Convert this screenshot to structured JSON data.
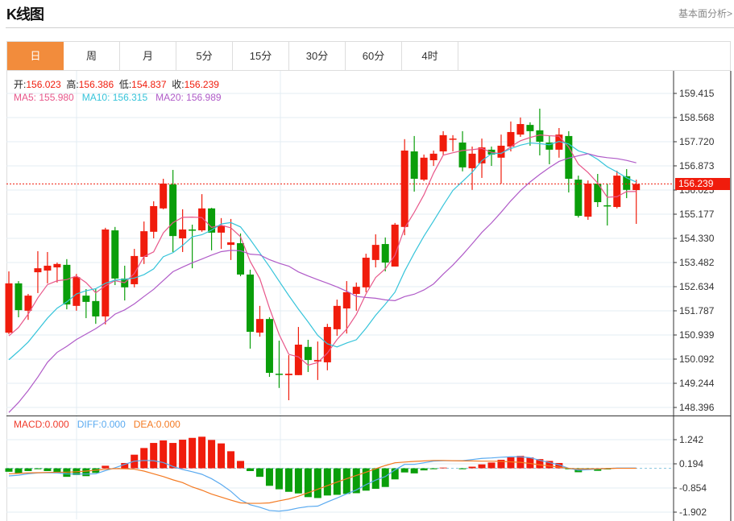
{
  "header": {
    "title": "K线图",
    "link": "基本面分析>"
  },
  "tabs": [
    {
      "label": "日",
      "active": true
    },
    {
      "label": "周"
    },
    {
      "label": "月"
    },
    {
      "label": "5分"
    },
    {
      "label": "15分"
    },
    {
      "label": "30分"
    },
    {
      "label": "60分"
    },
    {
      "label": "4时"
    }
  ],
  "ohlc_legend": {
    "open_label": "开:",
    "open": "156.023",
    "high_label": "高:",
    "high": "156.386",
    "low_label": "低:",
    "low": "154.837",
    "close_label": "收:",
    "close": "156.239"
  },
  "ma_legend": {
    "ma5": "MA5: 155.980",
    "ma10": "MA10: 156.315",
    "ma20": "MA20: 156.989"
  },
  "macd_legend": {
    "macd": "MACD:0.000",
    "diff": "DIFF:0.000",
    "dea": "DEA:0.000"
  },
  "current_price": "156.239",
  "colors": {
    "up": "#f01c0c",
    "down": "#0a9e0a",
    "ma5": "#e8578a",
    "ma10": "#36c4da",
    "ma20": "#b05bc8",
    "diff": "#5aaaf0",
    "dea": "#f47a22",
    "active_tab": "#f28c3c"
  },
  "chart_data": [
    {
      "type": "candlestick",
      "y_ticks": [
        "159.415",
        "158.568",
        "157.720",
        "156.873",
        "156.025",
        "155.177",
        "154.330",
        "153.482",
        "152.634",
        "151.787",
        "150.939",
        "150.092",
        "149.244",
        "148.396"
      ],
      "ylim": [
        148.396,
        159.415
      ],
      "ohlc": [
        [
          151.02,
          153.17,
          150.97,
          152.75
        ],
        [
          152.75,
          152.83,
          151.56,
          151.81
        ],
        [
          151.79,
          152.38,
          151.47,
          152.32
        ],
        [
          153.14,
          153.88,
          152.41,
          153.28
        ],
        [
          153.2,
          153.85,
          152.75,
          153.37
        ],
        [
          153.31,
          153.48,
          152.78,
          153.43
        ],
        [
          153.4,
          153.6,
          151.84,
          152.01
        ],
        [
          151.96,
          153.08,
          151.79,
          152.97
        ],
        [
          152.32,
          152.55,
          151.53,
          152.1
        ],
        [
          152.13,
          152.55,
          151.33,
          151.59
        ],
        [
          151.59,
          154.7,
          151.31,
          154.64
        ],
        [
          154.61,
          154.73,
          152.69,
          152.92
        ],
        [
          152.92,
          153.37,
          152.15,
          152.61
        ],
        [
          152.72,
          153.96,
          152.61,
          153.71
        ],
        [
          153.68,
          154.92,
          153.43,
          154.58
        ],
        [
          154.56,
          155.63,
          154.33,
          155.46
        ],
        [
          155.38,
          156.42,
          155.35,
          156.25
        ],
        [
          156.22,
          156.73,
          153.85,
          154.41
        ],
        [
          154.33,
          155.35,
          153.85,
          154.64
        ],
        [
          154.64,
          154.81,
          153.28,
          154.61
        ],
        [
          154.61,
          155.88,
          154.56,
          155.38
        ],
        [
          155.38,
          155.4,
          153.91,
          154.53
        ],
        [
          154.53,
          155.04,
          153.96,
          154.78
        ],
        [
          154.1,
          155.01,
          153.57,
          154.19
        ],
        [
          154.16,
          154.5,
          153.0,
          153.06
        ],
        [
          153.06,
          153.23,
          150.46,
          151.05
        ],
        [
          151.02,
          151.96,
          150.88,
          151.5
        ],
        [
          151.5,
          151.56,
          149.47,
          149.61
        ],
        [
          149.58,
          150.74,
          149.08,
          149.56
        ],
        [
          149.53,
          150.23,
          148.65,
          149.58
        ],
        [
          149.53,
          151.22,
          149.53,
          150.6
        ],
        [
          150.52,
          150.77,
          149.64,
          150.06
        ],
        [
          150.01,
          150.71,
          149.36,
          150.06
        ],
        [
          149.98,
          151.33,
          149.7,
          151.22
        ],
        [
          151.14,
          152.18,
          150.91,
          151.96
        ],
        [
          151.87,
          152.83,
          150.99,
          152.44
        ],
        [
          152.38,
          152.78,
          151.79,
          152.63
        ],
        [
          152.61,
          153.79,
          152.44,
          153.65
        ],
        [
          153.57,
          154.47,
          153.31,
          154.1
        ],
        [
          154.13,
          154.36,
          153.17,
          153.48
        ],
        [
          153.34,
          154.87,
          153.34,
          154.81
        ],
        [
          154.73,
          157.81,
          154.44,
          157.41
        ],
        [
          157.38,
          157.92,
          155.97,
          156.42
        ],
        [
          156.39,
          157.27,
          156.34,
          157.16
        ],
        [
          157.07,
          157.41,
          156.87,
          157.3
        ],
        [
          157.38,
          158.09,
          157.24,
          157.95
        ],
        [
          157.81,
          157.95,
          157.38,
          157.83
        ],
        [
          157.69,
          158.09,
          156.68,
          156.82
        ],
        [
          156.79,
          157.55,
          156.03,
          157.3
        ],
        [
          156.96,
          157.83,
          156.45,
          157.52
        ],
        [
          157.44,
          157.55,
          156.87,
          157.27
        ],
        [
          157.16,
          157.97,
          156.25,
          157.58
        ],
        [
          157.55,
          158.43,
          157.38,
          158.06
        ],
        [
          157.97,
          158.57,
          157.89,
          158.34
        ],
        [
          158.31,
          158.4,
          157.58,
          158.09
        ],
        [
          158.12,
          158.88,
          157.24,
          157.72
        ],
        [
          157.69,
          157.92,
          156.93,
          157.44
        ],
        [
          157.44,
          158.2,
          157.16,
          157.97
        ],
        [
          157.92,
          158.09,
          155.94,
          156.42
        ],
        [
          156.39,
          156.53,
          155.06,
          155.12
        ],
        [
          155.09,
          156.36,
          154.98,
          156.25
        ],
        [
          156.25,
          156.59,
          155.43,
          155.6
        ],
        [
          155.49,
          156.25,
          154.78,
          155.46
        ],
        [
          155.43,
          156.7,
          155.38,
          156.53
        ],
        [
          156.51,
          156.76,
          155.74,
          156.03
        ],
        [
          156.023,
          156.386,
          154.837,
          156.239
        ]
      ],
      "ma5_lead": [
        150.91,
        151.2,
        151.67,
        152.24
      ],
      "ma10_lead": [
        150.07,
        150.37,
        150.69,
        151.11,
        151.53,
        151.88,
        152.1,
        152.38,
        152.49
      ],
      "ma20_lead": [
        148.22,
        148.57,
        148.99,
        149.46,
        149.98,
        150.33,
        150.54,
        150.78,
        150.97,
        151.16,
        151.39,
        151.67,
        151.82,
        152.03,
        152.29,
        152.54,
        152.85,
        153.16,
        153.32
      ]
    },
    {
      "type": "bar+line",
      "y_ticks": [
        "1.242",
        "0.194",
        "-0.854",
        "-1.902"
      ],
      "ylim": [
        -1.902,
        1.242
      ],
      "macd": [
        -0.15,
        -0.21,
        -0.12,
        -0.04,
        -0.12,
        -0.21,
        -0.37,
        -0.29,
        -0.34,
        -0.2,
        0.11,
        0.0,
        0.23,
        0.59,
        0.88,
        1.1,
        1.21,
        1.1,
        1.24,
        1.32,
        1.37,
        1.23,
        1.08,
        0.74,
        0.32,
        -0.12,
        -0.37,
        -0.76,
        -0.91,
        -1.02,
        -1.09,
        -1.25,
        -1.29,
        -1.18,
        -1.15,
        -1.11,
        -1.08,
        -0.97,
        -0.89,
        -0.81,
        -0.48,
        -0.18,
        -0.22,
        -0.09,
        -0.04,
        0.03,
        0.0,
        -0.04,
        0.07,
        0.17,
        0.25,
        0.37,
        0.48,
        0.54,
        0.47,
        0.4,
        0.32,
        0.23,
        -0.04,
        -0.17,
        -0.06,
        -0.11,
        -0.05,
        0.0,
        0.0,
        0.0
      ],
      "diff": [
        -0.33,
        -0.3,
        -0.24,
        -0.2,
        -0.19,
        -0.2,
        -0.24,
        -0.25,
        -0.25,
        -0.24,
        -0.1,
        0.02,
        0.17,
        0.31,
        0.34,
        0.33,
        0.25,
        0.08,
        -0.05,
        -0.15,
        -0.26,
        -0.45,
        -0.7,
        -1.0,
        -1.37,
        -1.58,
        -1.69,
        -1.83,
        -1.86,
        -1.81,
        -1.72,
        -1.66,
        -1.64,
        -1.46,
        -1.29,
        -1.11,
        -0.94,
        -0.71,
        -0.51,
        -0.36,
        -0.07,
        0.17,
        0.17,
        0.24,
        0.31,
        0.33,
        0.33,
        0.33,
        0.38,
        0.43,
        0.45,
        0.48,
        0.5,
        0.5,
        0.46,
        0.35,
        0.25,
        0.15,
        0.0,
        -0.08,
        -0.06,
        -0.03,
        -0.01,
        0.01,
        0.01,
        0.01
      ],
      "dea": [
        -0.24,
        -0.22,
        -0.2,
        -0.19,
        -0.18,
        -0.17,
        -0.17,
        -0.15,
        -0.12,
        -0.08,
        -0.04,
        -0.01,
        -0.02,
        -0.04,
        -0.12,
        -0.24,
        -0.36,
        -0.5,
        -0.62,
        -0.81,
        -0.95,
        -1.12,
        -1.25,
        -1.38,
        -1.5,
        -1.52,
        -1.52,
        -1.5,
        -1.41,
        -1.33,
        -1.21,
        -1.06,
        -0.91,
        -0.75,
        -0.6,
        -0.45,
        -0.31,
        -0.17,
        -0.02,
        0.12,
        0.24,
        0.27,
        0.3,
        0.32,
        0.34,
        0.34,
        0.33,
        0.32,
        0.32,
        0.31,
        0.31,
        0.3,
        0.28,
        0.26,
        0.21,
        0.15,
        0.1,
        0.05,
        0.0,
        -0.03,
        -0.03,
        -0.02,
        -0.01,
        0.0,
        0.0,
        0.0
      ]
    }
  ]
}
